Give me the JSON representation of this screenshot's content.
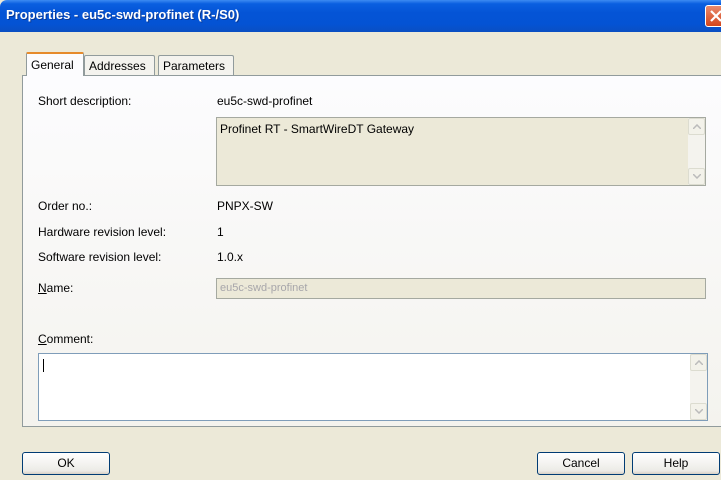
{
  "window": {
    "title": "Properties - eu5c-swd-profinet  (R-/S0)"
  },
  "tabs": [
    {
      "label": "General",
      "active": true
    },
    {
      "label": "Addresses",
      "active": false
    },
    {
      "label": "Parameters",
      "active": false
    }
  ],
  "general": {
    "short_description_label": "Short description:",
    "short_description_value": "eu5c-swd-profinet",
    "description_text": "Profinet RT - SmartWireDT Gateway",
    "order_no_label": "Order no.:",
    "order_no_value": "PNPX-SW",
    "hw_rev_label": "Hardware revision level:",
    "hw_rev_value": "1",
    "sw_rev_label": "Software revision level:",
    "sw_rev_value": "1.0.x",
    "name_label_mnemonic": "N",
    "name_label_rest": "ame:",
    "name_value": "eu5c-swd-profinet",
    "comment_label_mnemonic": "C",
    "comment_label_rest": "omment:",
    "comment_value": ""
  },
  "buttons": {
    "ok": "OK",
    "cancel": "Cancel",
    "help": "Help"
  },
  "icons": {
    "close": "close-icon",
    "scroll_up": "scroll-up-arrow-icon",
    "scroll_down": "scroll-down-arrow-icon"
  },
  "colors": {
    "titlebar": "#0454d6",
    "dialog_bg": "#ece9d8",
    "active_tab_accent": "#e68b2c",
    "close_button": "#d3451c"
  }
}
